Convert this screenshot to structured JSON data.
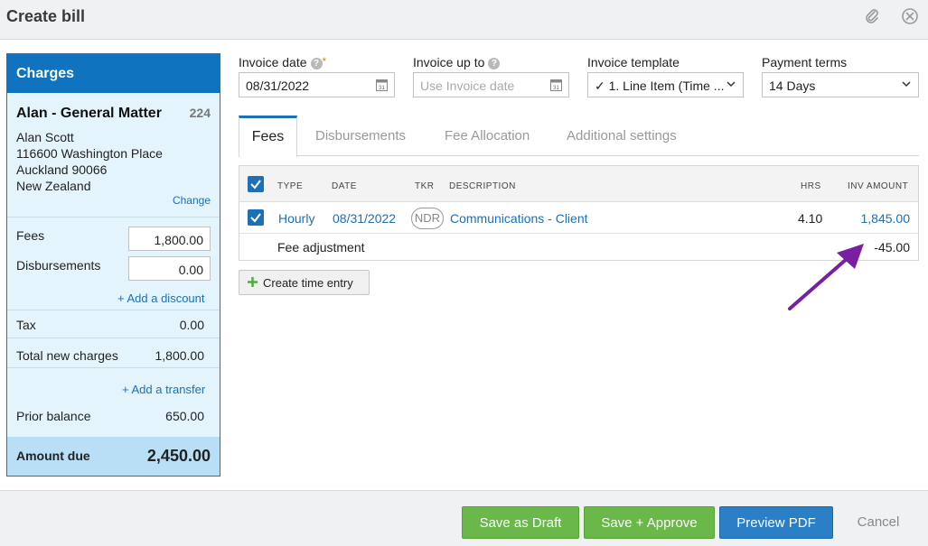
{
  "window": {
    "title": "Create bill"
  },
  "charges": {
    "heading": "Charges",
    "matter_name": "Alan - General Matter",
    "matter_number": "224",
    "client_name": "Alan Scott",
    "address_line1": "116600 Washington Place",
    "address_line2": "Auckland 90066",
    "address_line3": "New Zealand",
    "change_label": "Change",
    "fees_label": "Fees",
    "fees_value": "1,800.00",
    "disbursements_label": "Disbursements",
    "disbursements_value": "0.00",
    "add_discount_label": "+ Add a discount",
    "tax_label": "Tax",
    "tax_value": "0.00",
    "total_label": "Total new charges",
    "total_value": "1,800.00",
    "add_transfer_label": "+ Add a transfer",
    "prior_balance_label": "Prior balance",
    "prior_balance_value": "650.00",
    "amount_due_label": "Amount due",
    "amount_due_value": "2,450.00"
  },
  "fields": {
    "invoice_date_label": "Invoice date",
    "invoice_date_required": "*",
    "invoice_date_value": "08/31/2022",
    "invoice_up_to_label": "Invoice up to",
    "invoice_up_to_placeholder": "Use Invoice date",
    "invoice_template_label": "Invoice template",
    "invoice_template_value": "✓ 1. Line Item (Time ...",
    "payment_terms_label": "Payment terms",
    "payment_terms_value": "14 Days",
    "calendar_icon_text": "31"
  },
  "tabs": [
    {
      "label": "Fees",
      "active": true
    },
    {
      "label": "Disbursements",
      "active": false
    },
    {
      "label": "Fee Allocation",
      "active": false
    },
    {
      "label": "Additional settings",
      "active": false
    }
  ],
  "table": {
    "headers": {
      "type": "TYPE",
      "date": "DATE",
      "tkr": "TKR",
      "description": "DESCRIPTION",
      "hrs": "HRS",
      "inv_amount": "INV AMOUNT"
    },
    "rows": [
      {
        "type": "Hourly",
        "date": "08/31/2022",
        "tkr": "NDR",
        "description": "Communications - Client",
        "hrs": "4.10",
        "inv_amount": "1,845.00",
        "checked": true
      }
    ],
    "adjustment_label": "Fee adjustment",
    "adjustment_value": "-45.00"
  },
  "create_time_entry_label": "Create time entry",
  "footer": {
    "save_draft": "Save as Draft",
    "save_approve": "Save + Approve",
    "preview_pdf": "Preview PDF",
    "cancel": "Cancel"
  },
  "colors": {
    "accent_blue": "#1d6fb8",
    "green_button": "#6ab74a",
    "annotation_arrow": "#7a1fa2"
  },
  "icons": [
    "paperclip-icon",
    "close-icon",
    "help-icon",
    "calendar-icon",
    "chevron-down-icon",
    "checkbox-icon",
    "plus-icon",
    "arrow-annotation"
  ]
}
